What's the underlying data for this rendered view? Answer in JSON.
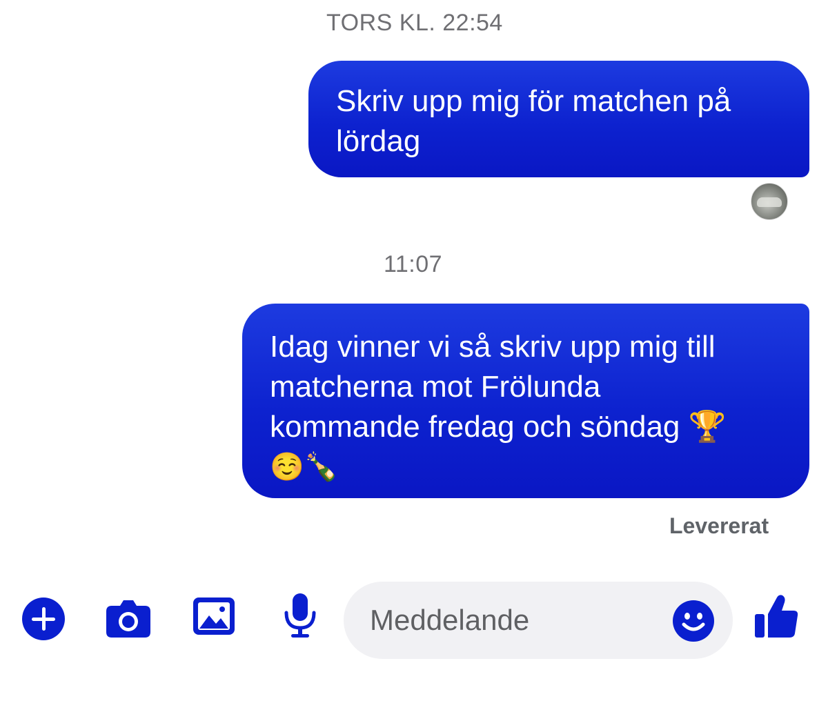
{
  "conversation": {
    "timestamps": [
      "TORS KL. 22:54",
      "11:07"
    ],
    "messages": [
      {
        "lines": [
          "Skriv upp mig för matchen på",
          "lördag"
        ]
      },
      {
        "lines": [
          "Idag vinner vi så skriv upp mig till",
          "matcherna mot Frölunda",
          "kommande fredag och söndag 🏆",
          "☺️🍾"
        ]
      }
    ],
    "status": "Levererat"
  },
  "composer": {
    "placeholder": "Meddelande",
    "icons": [
      "plus-icon",
      "camera-icon",
      "gallery-icon",
      "microphone-icon",
      "smiley-icon",
      "thumbs-up-icon"
    ]
  },
  "colors": {
    "accent": "#0a1fcf",
    "bubble": "#1230d8",
    "bubble_text": "#ffffff",
    "timestamp": "#6f6f73",
    "field_bg": "#f1f1f4"
  }
}
